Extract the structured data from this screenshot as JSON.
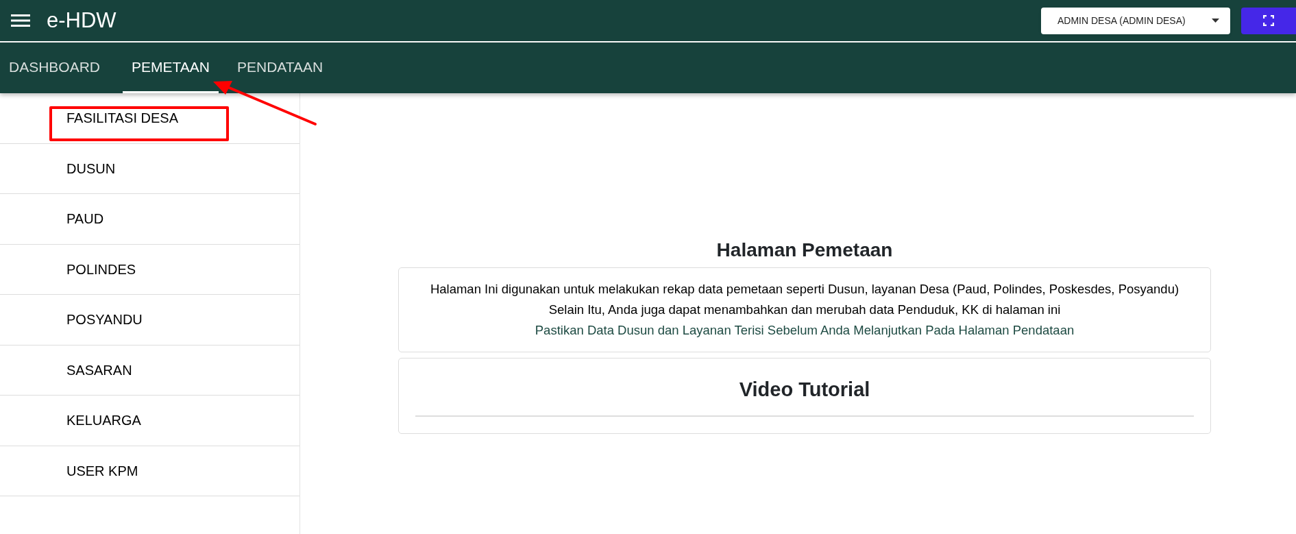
{
  "app_title": "e-HDW",
  "user_menu": {
    "label": "ADMIN DESA (ADMIN DESA)"
  },
  "tabs": [
    {
      "label": "DASHBOARD",
      "selected": false
    },
    {
      "label": "PEMETAAN",
      "selected": true
    },
    {
      "label": "PENDATAAN",
      "selected": false
    }
  ],
  "sidebar": {
    "items": [
      {
        "label": "FASILITASI DESA"
      },
      {
        "label": "DUSUN"
      },
      {
        "label": "PAUD"
      },
      {
        "label": "POLINDES"
      },
      {
        "label": "POSYANDU"
      },
      {
        "label": "SASARAN"
      },
      {
        "label": "KELUARGA"
      },
      {
        "label": "USER KPM"
      }
    ]
  },
  "page_heading": "Halaman Pemetaan",
  "info_card": {
    "lines": [
      {
        "kind": "plain",
        "text": "Halaman Ini digunakan untuk melakukan rekap data pemetaan seperti Dusun, layanan Desa (Paud, Polindes, Poskesdes, Posyandu)"
      },
      {
        "kind": "plain",
        "text": "Selain Itu, Anda juga dapat menambahkan dan merubah data Penduduk, KK di halaman ini"
      },
      {
        "kind": "note",
        "text": "Pastikan Data Dusun dan Layanan Terisi Sebelum Anda Melanjutkan Pada Halaman Pendataan"
      }
    ]
  },
  "video_card": {
    "heading": "Video Tutorial"
  },
  "annotations": {
    "highlight_box": true,
    "pointer_arrow": true
  }
}
